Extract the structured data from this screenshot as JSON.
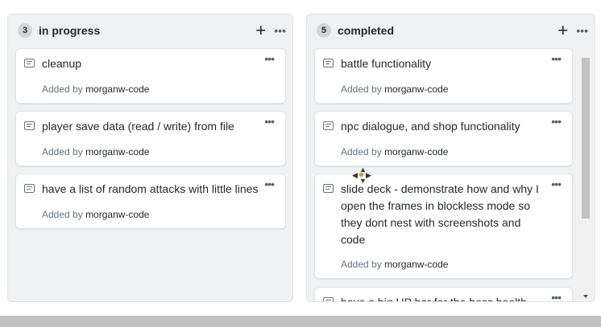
{
  "columns": [
    {
      "title": "in progress",
      "count": "3",
      "cards": [
        {
          "title": "cleanup",
          "added_prefix": "Added by",
          "author": "morganw-code"
        },
        {
          "title": "player save data (read / write) from file",
          "added_prefix": "Added by",
          "author": "morganw-code"
        },
        {
          "title": "have a list of random attacks with little lines",
          "added_prefix": "Added by",
          "author": "morganw-code"
        }
      ]
    },
    {
      "title": "completed",
      "count": "5",
      "cards": [
        {
          "title": "battle functionality",
          "added_prefix": "Added by",
          "author": "morganw-code"
        },
        {
          "title": "npc dialogue, and shop functionality",
          "added_prefix": "Added by",
          "author": "morganw-code"
        },
        {
          "title": "slide deck - demonstrate how and why I open the frames in blockless mode so they dont nest with screenshots and code",
          "added_prefix": "Added by",
          "author": "morganw-code"
        },
        {
          "title": "have a big HP bar for the boss health"
        }
      ]
    }
  ],
  "icons": {
    "add": "+",
    "more": "•••"
  }
}
